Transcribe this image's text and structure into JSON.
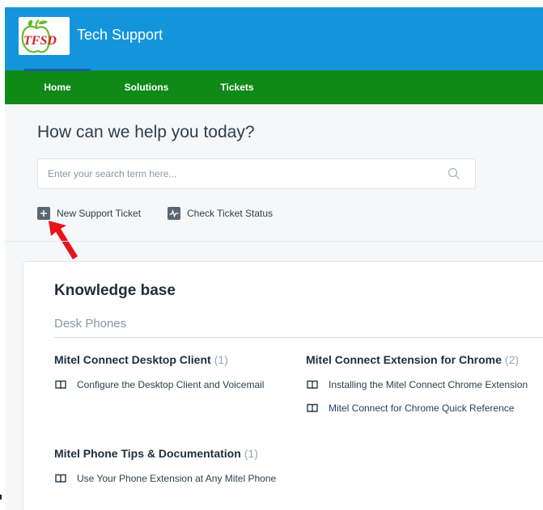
{
  "header": {
    "logo_text": "TFSD",
    "brand": "Tech Support",
    "colors": {
      "header": "#1495db",
      "nav": "#0f8a16",
      "active_underline": "#1d5fa8"
    }
  },
  "nav": {
    "items": [
      {
        "label": "Home",
        "active": true
      },
      {
        "label": "Solutions",
        "active": false
      },
      {
        "label": "Tickets",
        "active": false
      }
    ]
  },
  "main": {
    "title": "How can we help you today?",
    "search": {
      "placeholder": "Enter your search term here...",
      "value": "",
      "icon": "search-icon"
    },
    "actions": [
      {
        "label": "New Support Ticket",
        "icon": "plus-icon"
      },
      {
        "label": "Check Ticket Status",
        "icon": "status-pulse-icon"
      }
    ],
    "annotation": {
      "icon": "red-arrow-icon",
      "color": "#e8141b"
    }
  },
  "knowledge_base": {
    "title": "Knowledge base",
    "section": "Desk Phones",
    "folders": [
      {
        "title": "Mitel Connect Desktop Client",
        "count": "(1)",
        "articles": [
          "Configure the Desktop Client and Voicemail"
        ]
      },
      {
        "title": "Mitel Connect Extension for Chrome",
        "count": "(2)",
        "articles": [
          "Installing the Mitel Connect Chrome Extension",
          "Mitel Connect for Chrome Quick Reference"
        ]
      },
      {
        "title": "Mitel Phone Tips & Documentation",
        "count": "(1)",
        "articles": [
          "Use Your Phone Extension at Any Mitel Phone"
        ]
      }
    ]
  }
}
